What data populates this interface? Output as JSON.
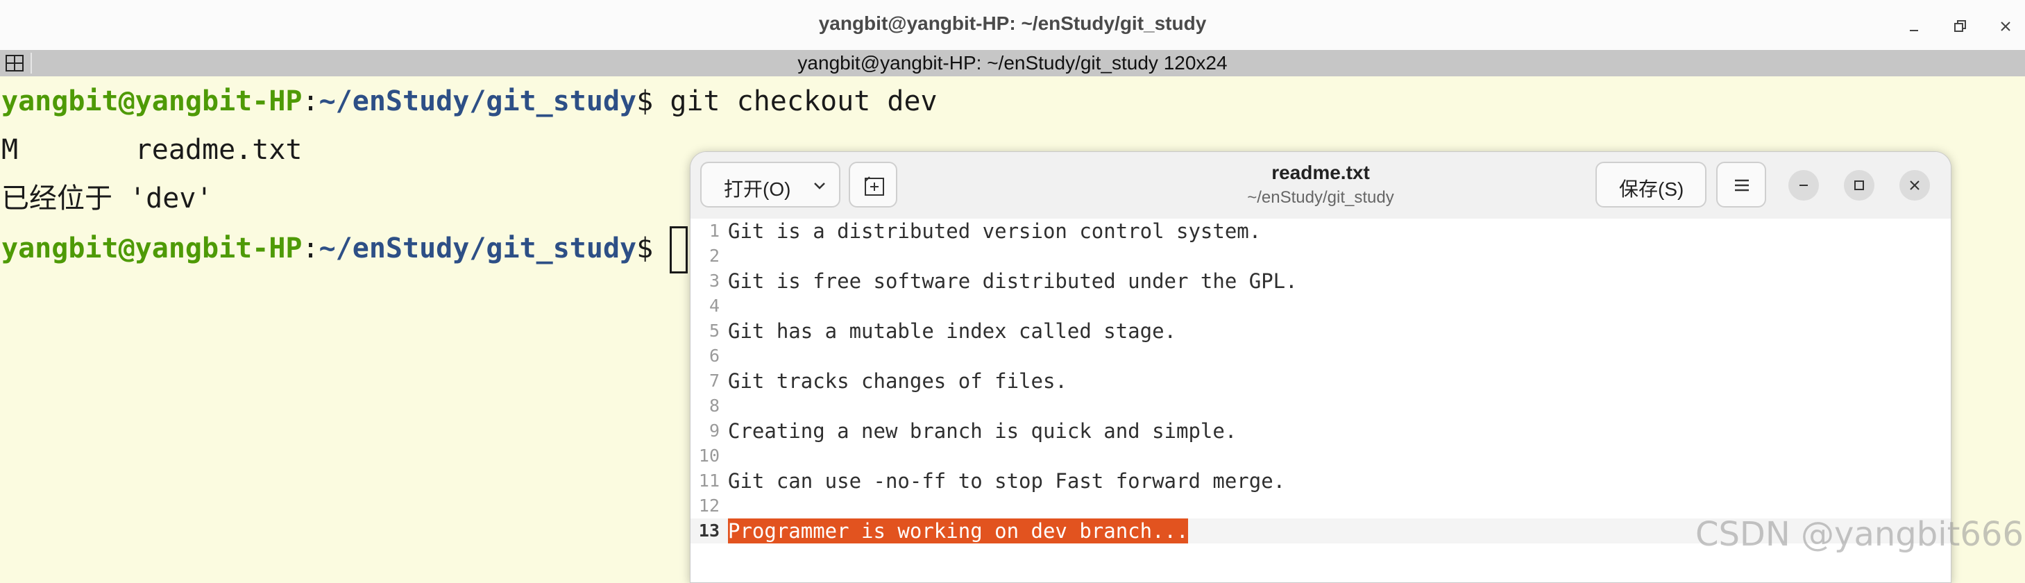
{
  "terminal": {
    "window_title": "yangbit@yangbit-HP: ~/enStudy/git_study",
    "tab_title": "yangbit@yangbit-HP: ~/enStudy/git_study 120x24",
    "prompt_user": "yangbit@yangbit-HP",
    "prompt_colon": ":",
    "prompt_path": "~/enStudy/git_study",
    "prompt_dollar": "$ ",
    "lines": [
      {
        "command": "git checkout dev"
      },
      {
        "output": "M       readme.txt"
      },
      {
        "output": "已经位于 'dev'"
      },
      {
        "command": ""
      }
    ]
  },
  "editor": {
    "open_label": "打开(O)",
    "save_label": "保存(S)",
    "title": "readme.txt",
    "subtitle": "~/enStudy/git_study",
    "lines": [
      {
        "num": "1",
        "text": "Git is a distributed version control system."
      },
      {
        "num": "2",
        "text": ""
      },
      {
        "num": "3",
        "text": "Git is free software distributed under the GPL."
      },
      {
        "num": "4",
        "text": ""
      },
      {
        "num": "5",
        "text": "Git has a mutable index called stage."
      },
      {
        "num": "6",
        "text": ""
      },
      {
        "num": "7",
        "text": "Git tracks changes of files."
      },
      {
        "num": "8",
        "text": ""
      },
      {
        "num": "9",
        "text": "Creating a new branch is quick and simple."
      },
      {
        "num": "10",
        "text": ""
      },
      {
        "num": "11",
        "text": "Git can use -no-ff to stop Fast forward merge."
      },
      {
        "num": "12",
        "text": ""
      },
      {
        "num": "13",
        "text": "Programmer is working on dev branch..."
      }
    ],
    "current_line": 13,
    "selection_color": "#e2531f"
  },
  "watermark": "CSDN @yangbit666",
  "colors": {
    "terminal_bg": "#fbfbe0",
    "prompt_user": "#4e9a06",
    "prompt_path": "#2d4f86"
  },
  "icons": {
    "minimize": "minimize-icon",
    "maximize": "maximize-icon",
    "close": "close-icon",
    "new_tab": "new-tab-icon",
    "menu": "hamburger-menu-icon",
    "dropdown": "chevron-down-icon",
    "tab_layout": "grid-icon"
  }
}
